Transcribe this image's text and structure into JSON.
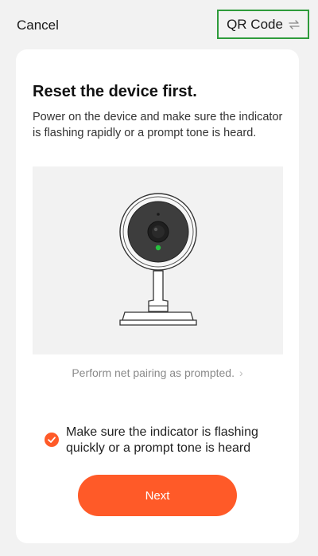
{
  "header": {
    "cancel_label": "Cancel",
    "qr_label": "QR Code",
    "qr_icon": "swap-arrows-icon"
  },
  "content": {
    "title": "Reset the device first.",
    "description": "Power on the device and make sure the indicator is flashing rapidly or a prompt tone is heard.",
    "illustration": "security-camera",
    "pairing_link": "Perform net pairing as prompted.",
    "confirm_checked": true,
    "confirm_text": "Make sure the indicator is flashing quickly or a prompt tone is heard",
    "next_label": "Next"
  },
  "colors": {
    "accent": "#ff5a28",
    "qr_highlight": "#2e9b3b",
    "indicator_led": "#27c13f"
  }
}
